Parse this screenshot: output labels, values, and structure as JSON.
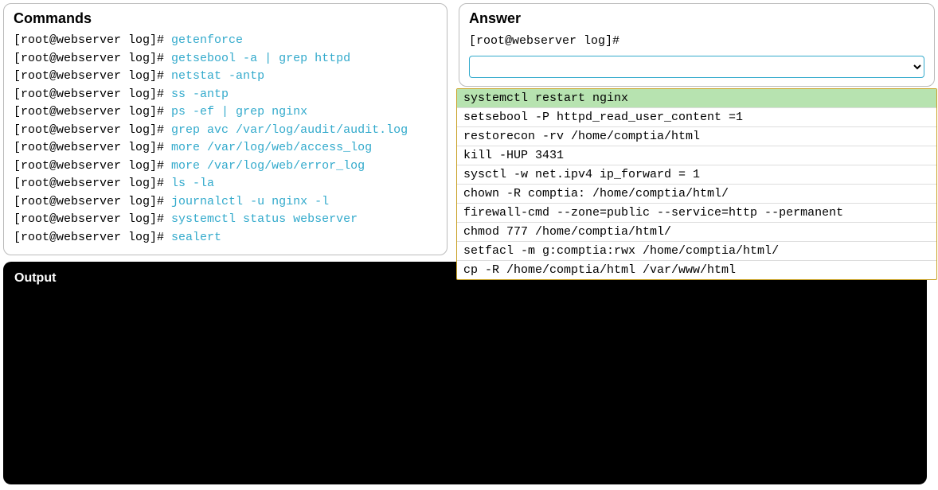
{
  "commands": {
    "title": "Commands",
    "prompt": "[root@webserver log]# ",
    "items": [
      "getenforce",
      "getsebool -a | grep httpd",
      "netstat -antp",
      "ss -antp",
      "ps -ef | grep nginx",
      "grep avc /var/log/audit/audit.log",
      "more /var/log/web/access_log",
      "more /var/log/web/error_log",
      "ls -la",
      "journalctl -u nginx -l",
      "systemctl status webserver",
      "sealert"
    ]
  },
  "answer": {
    "title": "Answer",
    "prompt": "[root@webserver log]#",
    "select_value": "",
    "options": [
      "systemctl restart nginx",
      "setsebool -P httpd_read_user_content =1",
      "restorecon -rv /home/comptia/html",
      "kill -HUP 3431",
      "sysctl -w net.ipv4 ip_forward = 1",
      "chown -R comptia: /home/comptia/html/",
      "firewall-cmd --zone=public --service=http --permanent",
      "chmod 777 /home/comptia/html/",
      "setfacl -m g:comptia:rwx /home/comptia/html/",
      "cp -R /home/comptia/html /var/www/html"
    ],
    "highlighted_index": 0
  },
  "output": {
    "title": "Output"
  }
}
